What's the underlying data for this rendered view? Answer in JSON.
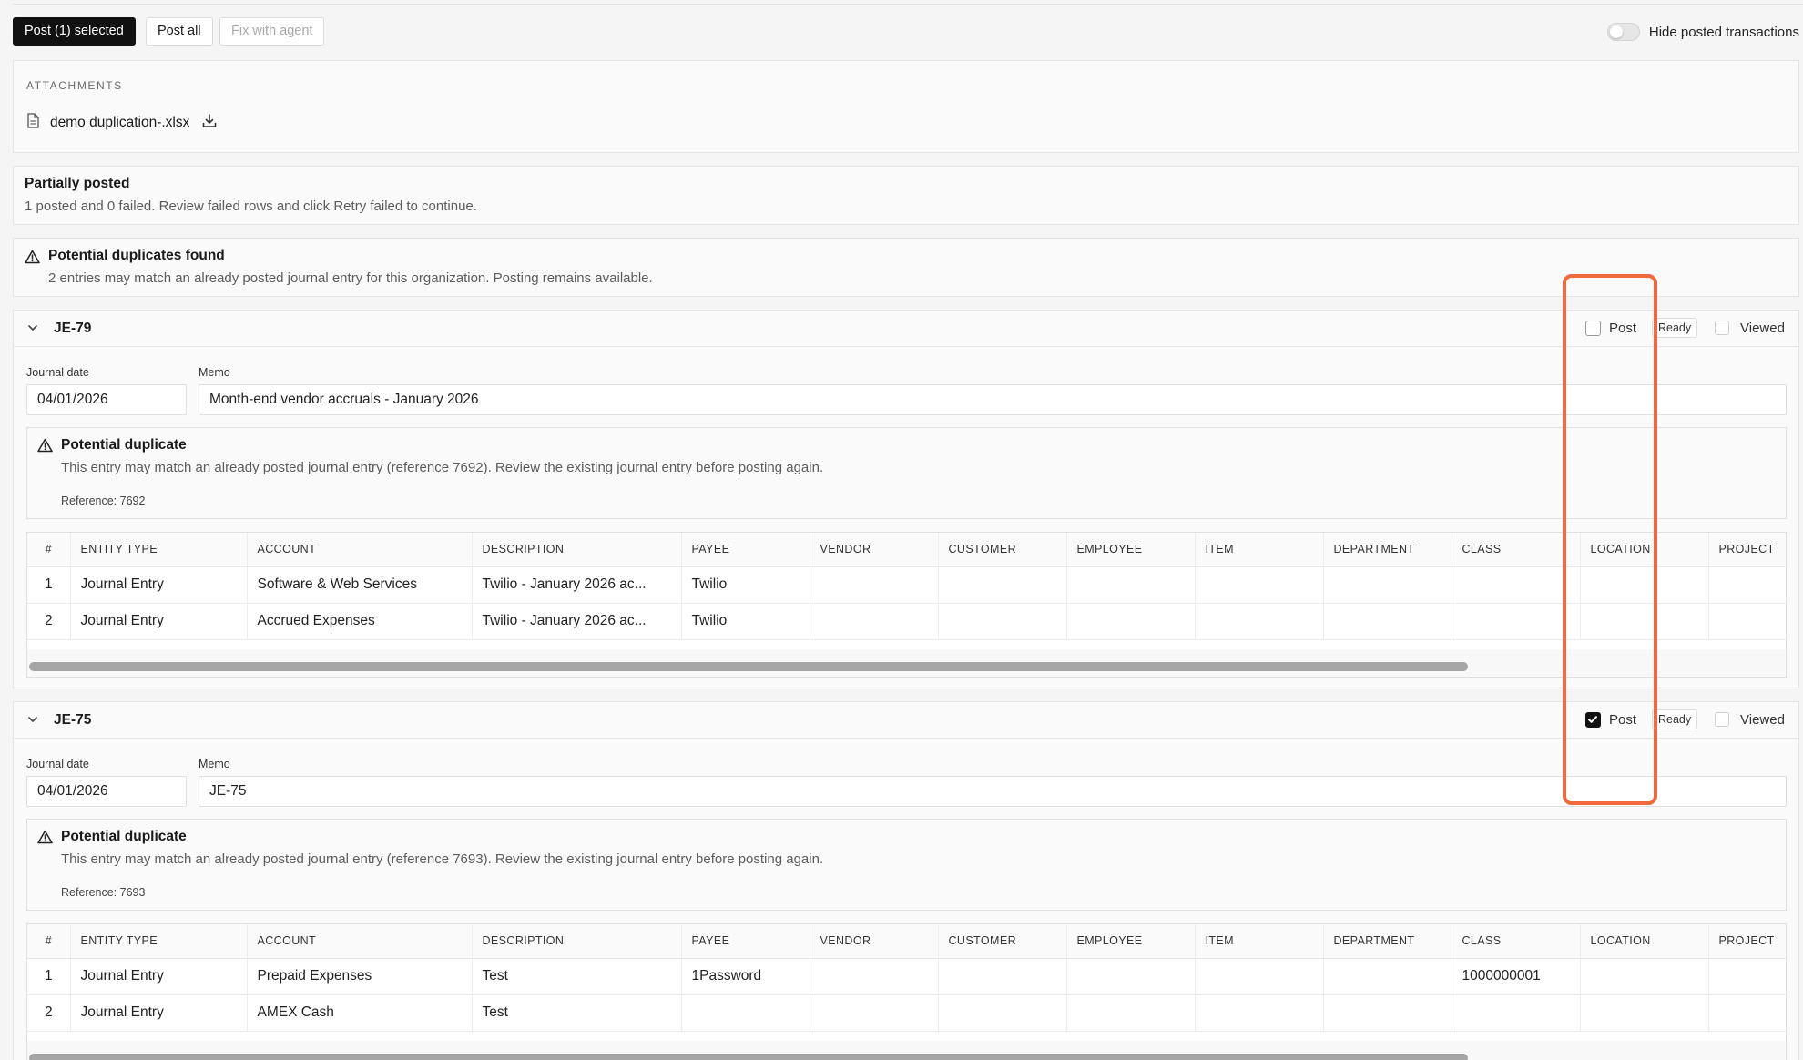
{
  "toolbar": {
    "post_selected_label": "Post (1) selected",
    "post_all_label": "Post all",
    "fix_with_agent_label": "Fix with agent",
    "hide_posted_label": "Hide posted transactions",
    "hide_posted_on": false
  },
  "attachments": {
    "title": "ATTACHMENTS",
    "file_name": "demo duplication-.xlsx"
  },
  "status": {
    "title": "Partially posted",
    "message": "1 posted and 0 failed. Review failed rows and click Retry failed to continue."
  },
  "duplicates_banner": {
    "title": "Potential duplicates found",
    "message": "2 entries may match an already posted journal entry for this organization. Posting remains available."
  },
  "columns": [
    "#",
    "ENTITY TYPE",
    "ACCOUNT",
    "DESCRIPTION",
    "PAYEE",
    "VENDOR",
    "CUSTOMER",
    "EMPLOYEE",
    "ITEM",
    "DEPARTMENT",
    "CLASS",
    "LOCATION",
    "PROJECT"
  ],
  "entries": [
    {
      "id": "JE-79",
      "post_label": "Post",
      "post_checked": false,
      "status_badge": "Ready",
      "viewed_label": "Viewed",
      "journal_date_label": "Journal date",
      "journal_date": "04/01/2026",
      "memo_label": "Memo",
      "memo": "Month-end vendor accruals - January 2026",
      "duplicate": {
        "title": "Potential duplicate",
        "message": "This entry may match an already posted journal entry (reference 7692). Review the existing journal entry before posting again.",
        "reference": "Reference: 7692"
      },
      "rows": [
        [
          "1",
          "Journal Entry",
          "Software & Web Services",
          "Twilio - January 2026 ac...",
          "Twilio",
          "",
          "",
          "",
          "",
          "",
          "",
          "",
          ""
        ],
        [
          "2",
          "Journal Entry",
          "Accrued Expenses",
          "Twilio - January 2026 ac...",
          "Twilio",
          "",
          "",
          "",
          "",
          "",
          "",
          "",
          ""
        ]
      ]
    },
    {
      "id": "JE-75",
      "post_label": "Post",
      "post_checked": true,
      "status_badge": "Ready",
      "viewed_label": "Viewed",
      "journal_date_label": "Journal date",
      "journal_date": "04/01/2026",
      "memo_label": "Memo",
      "memo": "JE-75",
      "duplicate": {
        "title": "Potential duplicate",
        "message": "This entry may match an already posted journal entry (reference 7693). Review the existing journal entry before posting again.",
        "reference": "Reference: 7693"
      },
      "rows": [
        [
          "1",
          "Journal Entry",
          "Prepaid Expenses",
          "Test",
          "1Password",
          "",
          "",
          "",
          "",
          "",
          "1000000001",
          "",
          ""
        ],
        [
          "2",
          "Journal Entry",
          "AMEX Cash",
          "Test",
          "",
          "",
          "",
          "",
          "",
          "",
          "",
          "",
          ""
        ]
      ]
    }
  ],
  "colors": {
    "highlight": "#f06a3e",
    "primary_button": "#111111"
  }
}
